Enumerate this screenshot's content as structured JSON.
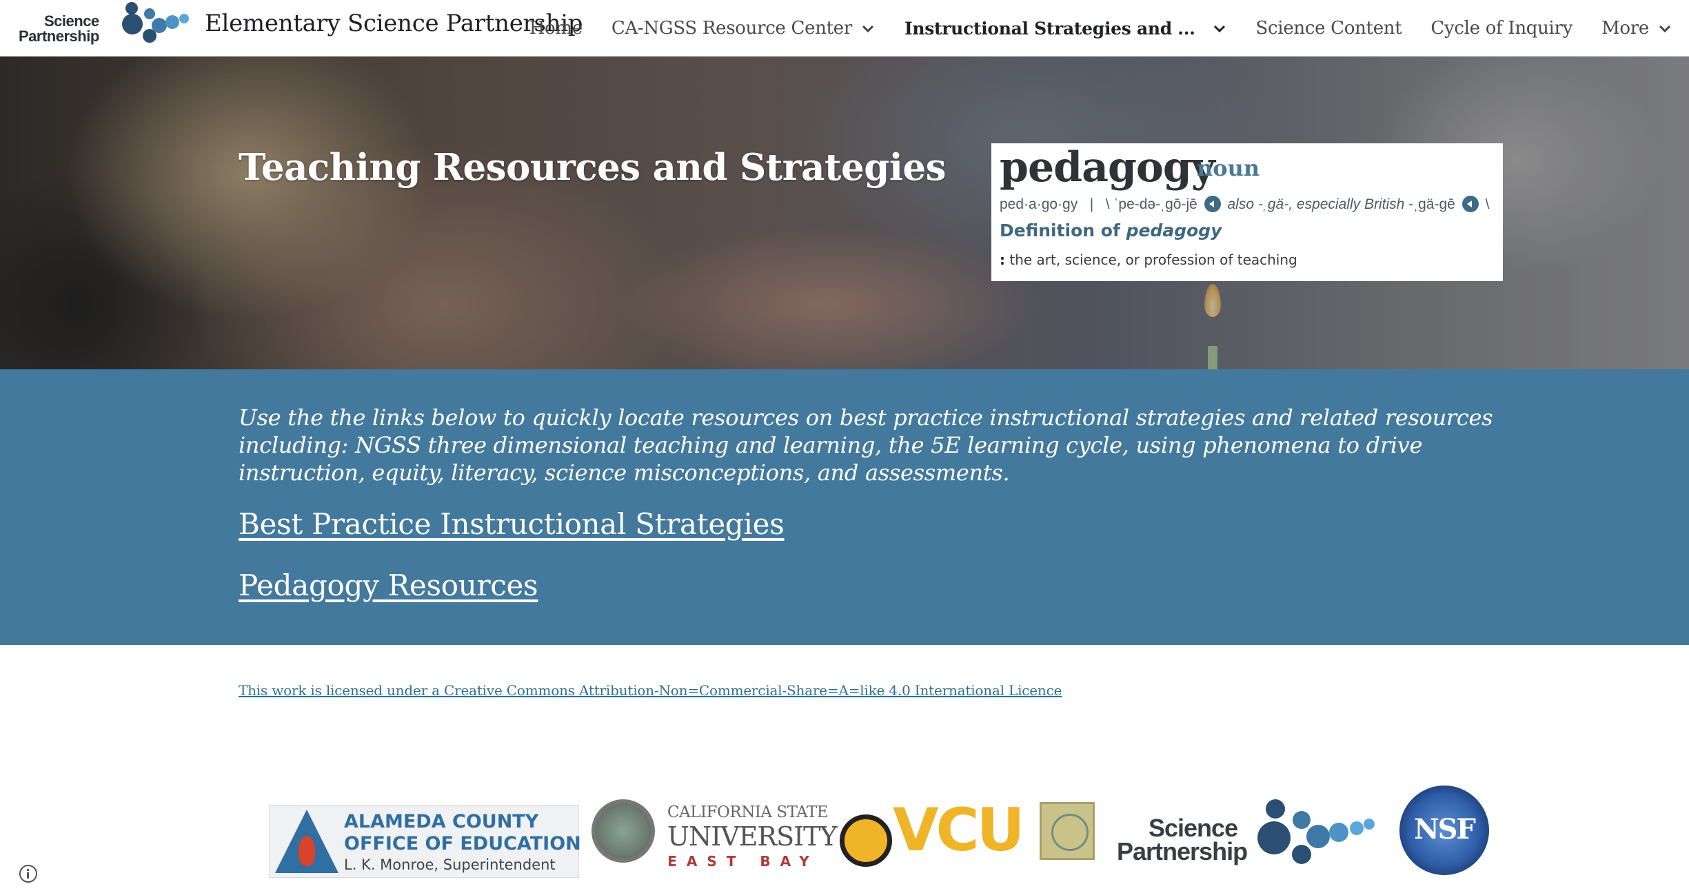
{
  "logo": {
    "line1": "Science",
    "line2": "Partnership"
  },
  "site_title": "Elementary Science Partnership",
  "nav": {
    "items": [
      {
        "label": "Home",
        "has_dropdown": false,
        "active": false
      },
      {
        "label": "CA-NGSS Resource Center",
        "has_dropdown": true,
        "active": false
      },
      {
        "label": "Instructional Strategies and ...",
        "has_dropdown": true,
        "active": true
      },
      {
        "label": "Science Content",
        "has_dropdown": false,
        "active": false
      },
      {
        "label": "Cycle of Inquiry",
        "has_dropdown": false,
        "active": false
      },
      {
        "label": "More",
        "has_dropdown": true,
        "active": false
      }
    ]
  },
  "hero": {
    "title": "Teaching Resources and Strategies",
    "dictionary": {
      "word": "pedagogy",
      "part_of_speech": "noun",
      "syllables": "ped·a·go·gy",
      "separator": "|",
      "pronunciation": "\\ ˈpe-də-ˌgō-jē",
      "also_label": "also",
      "alt_pron_1": "-ˌgä-,",
      "british_label": "especially British",
      "alt_pron_2": "-ˌgä-gē",
      "pron_end": "\\",
      "definition_heading_prefix": "Definition of",
      "definition_heading_word": "pedagogy",
      "definition_marker": ":",
      "definition_text": "the art, science, or profession of teaching"
    }
  },
  "band": {
    "description": "Use the the links below to quickly locate resources on best practice instructional strategies and related resources including: NGSS three dimensional teaching and learning, the 5E learning cycle, using phenomena to drive instruction, equity, literacy, science misconceptions, and assessments.",
    "links": [
      {
        "label": "Best Practice Instructional Strategies"
      },
      {
        "label": "Pedagogy Resources"
      }
    ]
  },
  "footer": {
    "license_text": "This work is licensed under a Creative Commons Attribution-Non=Commercial-Share=A=like 4.0 International Licence",
    "logos": {
      "acoe_line1": "ALAMEDA COUNTY",
      "acoe_line2": "OFFICE OF EDUCATION",
      "acoe_line3": "L. K. Monroe, Superintendent",
      "csueb_line1": "CALIFORNIA STATE",
      "csueb_line2": "UNIVERSITY",
      "csueb_line3": "EAST BAY",
      "vcu": "VCU",
      "sp_line1": "Science",
      "sp_line2": "Partnership",
      "nsf": "NSF"
    }
  },
  "colors": {
    "band_blue": "#43799d",
    "link_blue": "#2f6f92",
    "dict_accent": "#3e6880",
    "logo_dark_circle": "#2b4f72",
    "logo_light_circle": "#5aa7dc"
  },
  "icons": [
    "chevron-down-icon",
    "speaker-icon",
    "info-icon"
  ]
}
